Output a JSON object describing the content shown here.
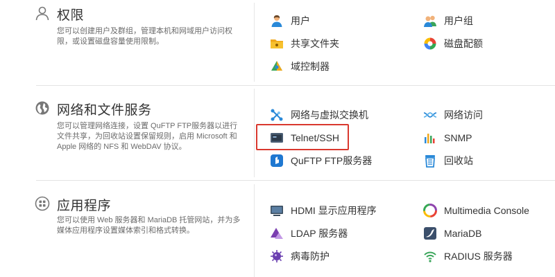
{
  "sections": [
    {
      "title": "权限",
      "icon": "user-outline-icon",
      "description": "您可以创建用户及群组，管理本机和网域用户访问权限，或设置磁盘容量使用限制。",
      "items": [
        {
          "label": "用户",
          "icon": "user-icon"
        },
        {
          "label": "用户组",
          "icon": "user-group-icon"
        },
        {
          "label": "共享文件夹",
          "icon": "shared-folder-icon"
        },
        {
          "label": "磁盘配额",
          "icon": "disk-quota-icon"
        },
        {
          "label": "域控制器",
          "icon": "domain-controller-icon"
        }
      ]
    },
    {
      "title": "网络和文件服务",
      "icon": "globe-icon",
      "description": "您可以管理网络连接，设置 QuFTP FTP服务器以进行文件共享，为回收站设置保留规则，启用 Microsoft 和 Apple 网络的 NFS 和 WebDAV 协议。",
      "items": [
        {
          "label": "网络与虚拟交换机",
          "icon": "network-switch-icon"
        },
        {
          "label": "网络访问",
          "icon": "network-access-icon"
        },
        {
          "label": "Telnet/SSH",
          "icon": "terminal-icon"
        },
        {
          "label": "SNMP",
          "icon": "snmp-chart-icon"
        },
        {
          "label": "QuFTP FTP服务器",
          "icon": "ftp-server-icon"
        },
        {
          "label": "回收站",
          "icon": "recycle-bin-icon"
        }
      ]
    },
    {
      "title": "应用程序",
      "icon": "apps-grid-icon",
      "description": "您可以使用 Web 服务器和 MariaDB 托管网站，并为多媒体应用程序设置媒体索引和格式转换。",
      "items": [
        {
          "label": "HDMI 显示应用程序",
          "icon": "hdmi-display-icon"
        },
        {
          "label": "Multimedia Console",
          "icon": "multimedia-console-icon"
        },
        {
          "label": "LDAP 服务器",
          "icon": "ldap-server-icon"
        },
        {
          "label": "MariaDB",
          "icon": "mariadb-icon"
        },
        {
          "label": "病毒防护",
          "icon": "antivirus-icon"
        },
        {
          "label": "RADIUS 服务器",
          "icon": "radius-server-icon"
        }
      ]
    }
  ],
  "highlight_color": "#d9382e"
}
